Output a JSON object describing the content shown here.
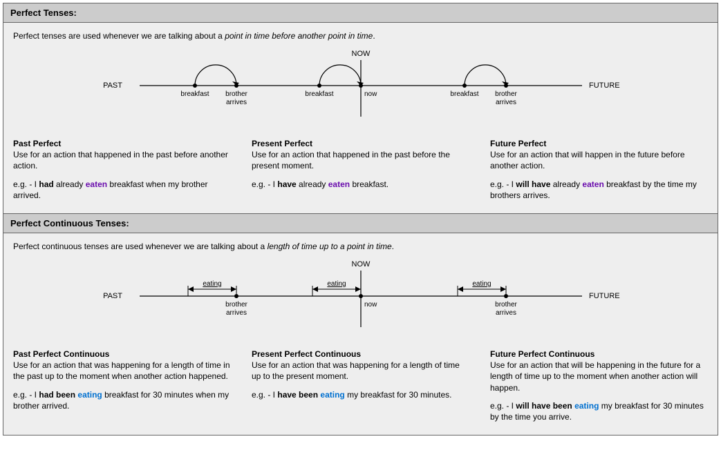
{
  "sections": {
    "perfect": {
      "header": "Perfect Tenses:",
      "intro_plain": "Perfect tenses are used whenever we are talking about a ",
      "intro_em": "point in time before another point in time",
      "intro_end": ".",
      "diagram": {
        "now_label": "NOW",
        "past_label": "PAST",
        "future_label": "FUTURE",
        "left_a": "breakfast",
        "left_b": "brother",
        "left_b2": "arrives",
        "mid_a": "breakfast",
        "mid_b": "now",
        "right_a": "breakfast",
        "right_b": "brother",
        "right_b2": "arrives"
      },
      "cols": {
        "past": {
          "title": "Past Perfect",
          "desc": "Use for an action that happened in the past before another action.",
          "eg_pre": "e.g. - I ",
          "eg_b1": "had",
          "eg_mid1": " already ",
          "eg_purple": "eaten",
          "eg_post": " breakfast when my brother arrived."
        },
        "present": {
          "title": "Present Perfect",
          "desc": "Use for an action that happened in the past before the present moment.",
          "eg_pre": "e.g. - I ",
          "eg_b1": "have",
          "eg_mid1": " already ",
          "eg_purple": "eaten",
          "eg_post": " breakfast."
        },
        "future": {
          "title": "Future Perfect",
          "desc": "Use for an action that will happen in the future before another action.",
          "eg_pre": "e.g. - I ",
          "eg_b1": "will have",
          "eg_mid1": " already ",
          "eg_purple": "eaten",
          "eg_post": " breakfast by the time my brothers arrives."
        }
      }
    },
    "perfect_cont": {
      "header": "Perfect Continuous Tenses:",
      "intro_plain": "Perfect continuous tenses are used whenever we are talking about a ",
      "intro_em": "length of time up to a point in time",
      "intro_end": ".",
      "diagram": {
        "now_label": "NOW",
        "past_label": "PAST",
        "future_label": "FUTURE",
        "span_label": "eating",
        "left_b": "brother",
        "left_b2": "arrives",
        "mid_b": "now",
        "right_b": "brother",
        "right_b2": "arrives"
      },
      "cols": {
        "past": {
          "title": "Past Perfect Continuous",
          "desc": "Use for an action that was happening for a length of time in the past up to the moment when another action happened.",
          "eg_pre": "e.g. - I ",
          "eg_b1": "had been",
          "eg_sp": " ",
          "eg_blue": "eating",
          "eg_post": " breakfast for 30 minutes when my brother arrived."
        },
        "present": {
          "title": "Present Perfect Continuous",
          "desc": "Use for an action that was happening for a length of time up to the present moment.",
          "eg_pre": "e.g. - I ",
          "eg_b1": "have been",
          "eg_sp": " ",
          "eg_blue": "eating",
          "eg_post": " my breakfast for 30 minutes."
        },
        "future": {
          "title": "Future Perfect Continuous",
          "desc": "Use for an action that will be happening in the future for a length of time up to the moment when another action will happen.",
          "eg_pre": "e.g. - I ",
          "eg_b1": "will have been",
          "eg_sp": " ",
          "eg_blue": "eating",
          "eg_post": " my breakfast for 30 minutes by the time you arrive."
        }
      }
    }
  }
}
